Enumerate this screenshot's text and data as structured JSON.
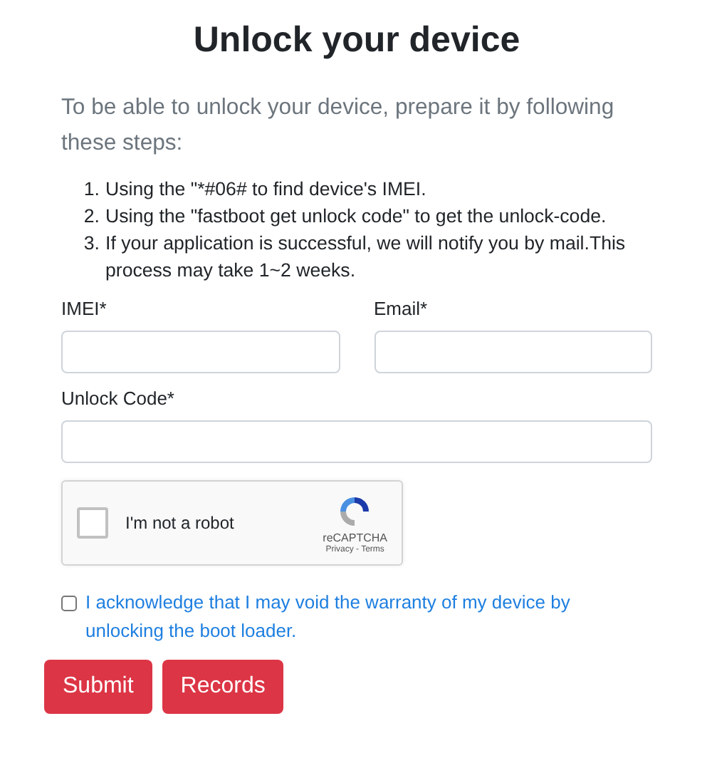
{
  "title": "Unlock your device",
  "intro": "To be able to unlock your device, prepare it by following these steps:",
  "steps": [
    {
      "number": "1.",
      "text": "Using the \"*#06# to find device's IMEI."
    },
    {
      "number": "2.",
      "text": "Using the \"fastboot get unlock code\" to get the unlock-code."
    },
    {
      "number": "3.",
      "text": "If your application is successful, we will notify you by mail.This process may take 1~2 weeks."
    }
  ],
  "fields": [
    {
      "label": "IMEI*",
      "kind": "half"
    },
    {
      "label": "Email*",
      "kind": "half"
    },
    {
      "label": "Unlock Code*",
      "kind": "full"
    }
  ],
  "captcha": {
    "label": "I'm not a robot",
    "checked": false,
    "brand": "reCAPTCHA",
    "links": "Privacy - Terms"
  },
  "acknowledge": {
    "text": "I acknowledge that I may void the warranty of my device by unlocking the boot loader.",
    "checked": false
  },
  "buttons": [
    "Submit",
    "Records"
  ]
}
